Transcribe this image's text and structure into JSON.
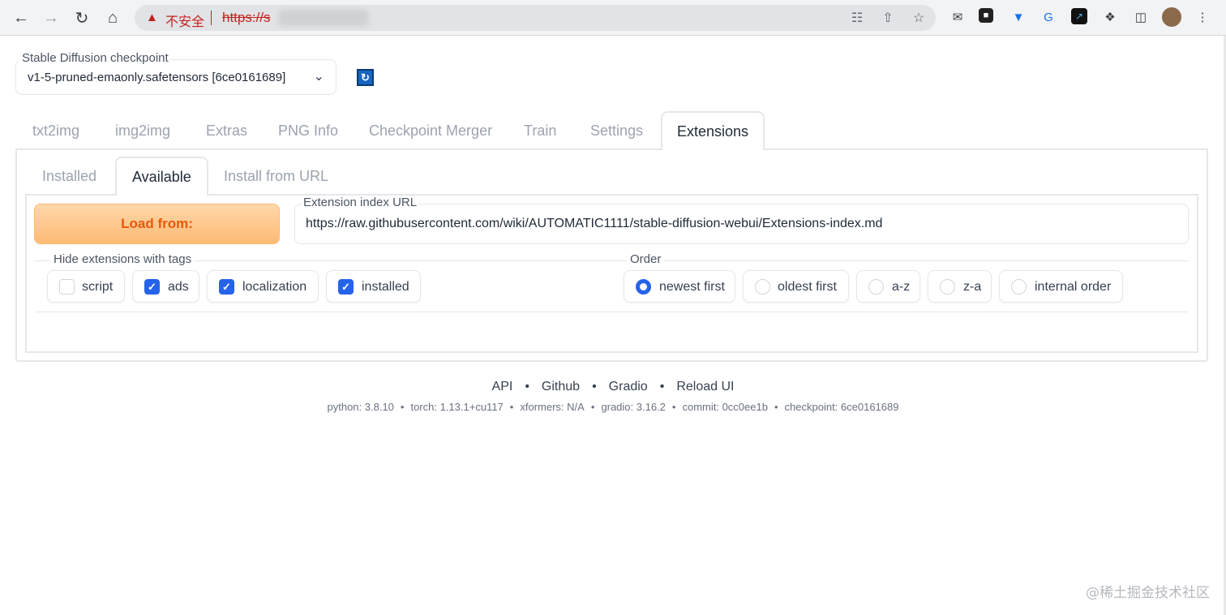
{
  "browser": {
    "insecure_label": "不安全",
    "url_text": "https://s",
    "icons": [
      "back-icon",
      "forward-icon",
      "reload-icon",
      "home-icon",
      "warning-icon",
      "translate-icon",
      "share-icon",
      "star-icon",
      "mail-icon",
      "extension-icon",
      "puzzle-icon",
      "sidepanel-icon",
      "profile-avatar",
      "menu-icon"
    ]
  },
  "checkpoint": {
    "label": "Stable Diffusion checkpoint",
    "value": "v1-5-pruned-emaonly.safetensors [6ce0161689]"
  },
  "main_tabs": [
    {
      "label": "txt2img"
    },
    {
      "label": "img2img"
    },
    {
      "label": "Extras"
    },
    {
      "label": "PNG Info"
    },
    {
      "label": "Checkpoint Merger"
    },
    {
      "label": "Train"
    },
    {
      "label": "Settings"
    },
    {
      "label": "Extensions"
    }
  ],
  "sub_tabs": [
    {
      "label": "Installed"
    },
    {
      "label": "Available"
    },
    {
      "label": "Install from URL"
    }
  ],
  "available": {
    "load_button": "Load from:",
    "index_url_label": "Extension index URL",
    "index_url_value": "https://raw.githubusercontent.com/wiki/AUTOMATIC1111/stable-diffusion-webui/Extensions-index.md",
    "hide_label": "Hide extensions with tags",
    "tags": [
      {
        "label": "script",
        "checked": false
      },
      {
        "label": "ads",
        "checked": true
      },
      {
        "label": "localization",
        "checked": true
      },
      {
        "label": "installed",
        "checked": true
      }
    ],
    "order_label": "Order",
    "orders": [
      {
        "label": "newest first",
        "selected": true
      },
      {
        "label": "oldest first",
        "selected": false
      },
      {
        "label": "a-z",
        "selected": false
      },
      {
        "label": "z-a",
        "selected": false
      },
      {
        "label": "internal order",
        "selected": false
      }
    ]
  },
  "footer": {
    "links": [
      "API",
      "Github",
      "Gradio",
      "Reload UI"
    ],
    "versions": [
      "python: 3.8.10",
      "torch: 1.13.1+cu117",
      "xformers: N/A",
      "gradio: 3.16.2",
      "commit: 0cc0ee1b",
      "checkpoint: 6ce0161689"
    ]
  },
  "watermark": "@稀土掘金技术社区",
  "colors": {
    "accent": "#2563eb",
    "load_button": "#fdba74",
    "load_text": "#ea580c",
    "insecure": "#c5221f"
  }
}
